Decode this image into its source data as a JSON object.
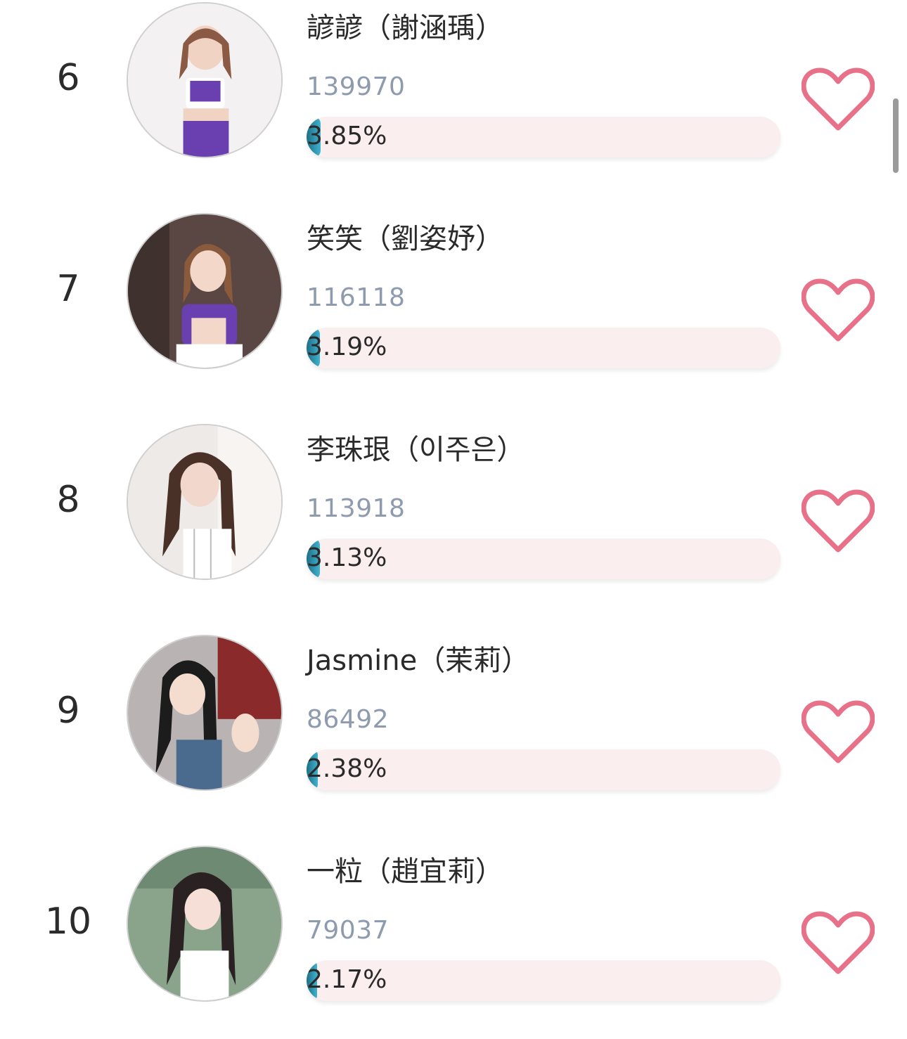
{
  "colors": {
    "heart": "#e8718a",
    "bar_track": "#fbeeee",
    "bar_fill_start": "#1f6e86",
    "bar_fill_end": "#3fb3cf",
    "votes_text": "#8e9aad"
  },
  "entries": [
    {
      "rank": "6",
      "name": "諺諺（謝涵瑀）",
      "votes": "139970",
      "percent_label": "3.85%",
      "percent": 3.85,
      "icon": "heart-outline-icon"
    },
    {
      "rank": "7",
      "name": "笑笑（劉姿妤）",
      "votes": "116118",
      "percent_label": "3.19%",
      "percent": 3.19,
      "icon": "heart-outline-icon"
    },
    {
      "rank": "8",
      "name": "李珠珢（이주은）",
      "votes": "113918",
      "percent_label": "3.13%",
      "percent": 3.13,
      "icon": "heart-outline-icon"
    },
    {
      "rank": "9",
      "name": "Jasmine（茉莉）",
      "votes": "86492",
      "percent_label": "2.38%",
      "percent": 2.38,
      "icon": "heart-outline-icon"
    },
    {
      "rank": "10",
      "name": "一粒（趙宜莉）",
      "votes": "79037",
      "percent_label": "2.17%",
      "percent": 2.17,
      "icon": "heart-outline-icon"
    }
  ]
}
